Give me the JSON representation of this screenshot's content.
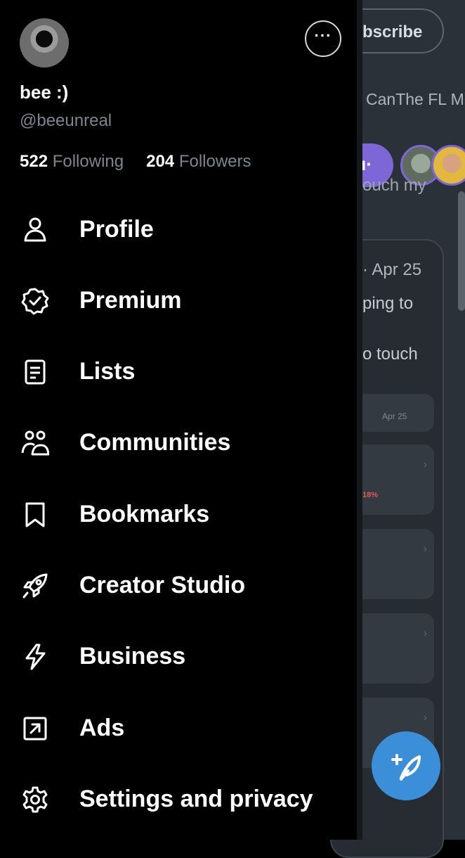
{
  "background": {
    "subscribe_label": "bscribe",
    "tabs_text": "CanThe FL M",
    "spaces_glyph": "ı·",
    "touch_text": "ouch my",
    "post_date": "· Apr 25",
    "post_line1": "ping to",
    "post_line2": "o touch",
    "mini_date": "Apr 25",
    "percent": "18%",
    "compose_icon": "compose-feather-icon"
  },
  "profile": {
    "display_name": "bee :)",
    "handle": "@beeunreal",
    "following_count": "522",
    "following_label": "Following",
    "followers_count": "204",
    "followers_label": "Followers",
    "more_label": "···"
  },
  "menu": [
    {
      "label": "Profile",
      "icon": "person-icon"
    },
    {
      "label": "Premium",
      "icon": "verified-badge-icon"
    },
    {
      "label": "Lists",
      "icon": "list-icon"
    },
    {
      "label": "Communities",
      "icon": "communities-icon"
    },
    {
      "label": "Bookmarks",
      "icon": "bookmark-icon"
    },
    {
      "label": "Creator Studio",
      "icon": "rocket-icon"
    },
    {
      "label": "Business",
      "icon": "lightning-icon"
    },
    {
      "label": "Ads",
      "icon": "external-arrow-icon"
    },
    {
      "label": "Settings and privacy",
      "icon": "gear-icon"
    }
  ],
  "colors": {
    "drawer_bg": "#000000",
    "secondary_text": "#7c8691",
    "accent_purple": "#7d67d6",
    "fab_blue": "#3b8fd9"
  }
}
